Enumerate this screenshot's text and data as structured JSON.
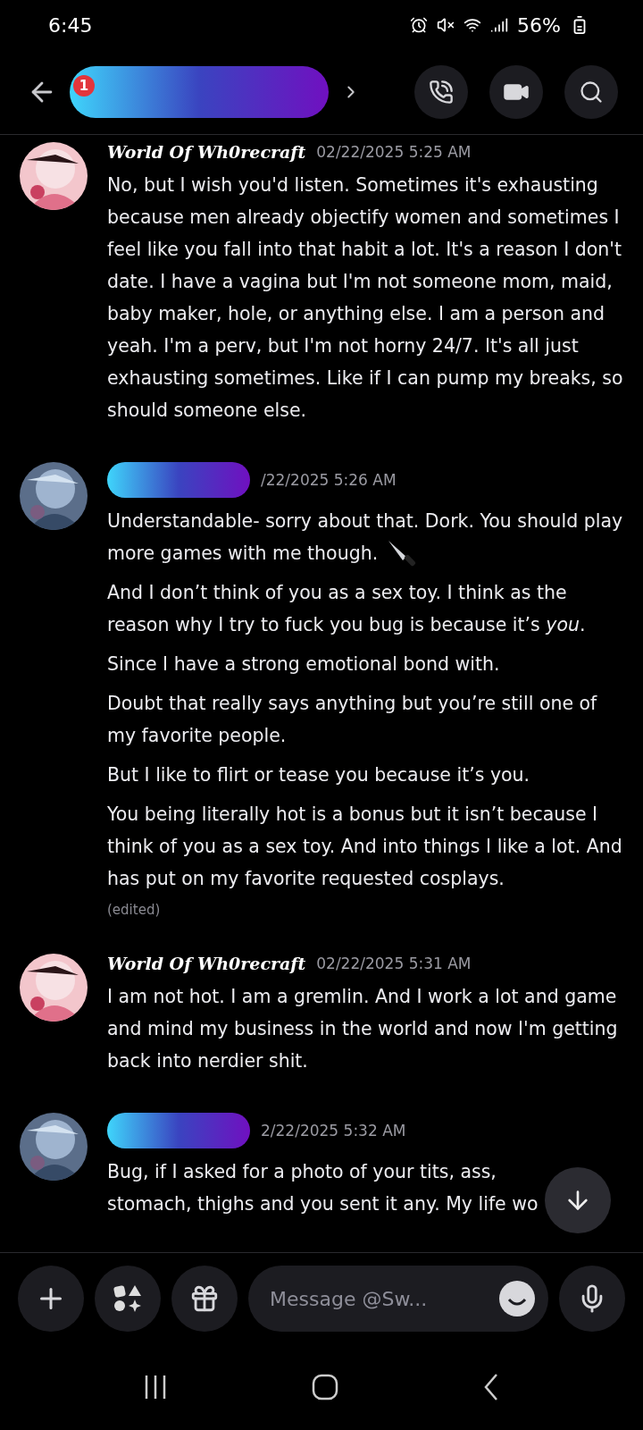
{
  "status_bar": {
    "time": "6:45",
    "battery": "56%"
  },
  "header": {
    "unread_badge": "1"
  },
  "messages": [
    {
      "author": "World Of Wh0recraft",
      "author_redacted": false,
      "timestamp": "02/22/2025 5:25 AM",
      "edited": false,
      "paragraphs": [
        {
          "text": "No, but I wish you'd listen. Sometimes it's exhausting because men already objectify women and sometimes I feel like you fall into that habit a lot. It's a reason I don't date. I have a vagina but I'm not someone mom, maid, baby maker, hole, or anything else. I am a person and yeah. I'm a perv, but I'm not horny 24/7. It's all just exhausting sometimes. Like if I can pump my breaks, so should someone else.",
          "has_emoji": false
        }
      ]
    },
    {
      "author_redacted": true,
      "timestamp": "/22/2025 5:26 AM",
      "edited": true,
      "edited_label": "(edited)",
      "paragraphs": [
        {
          "text": "Understandable- sorry about that. Dork. You should play more games with me though.",
          "has_emoji": true
        },
        {
          "text": "And I don’t think of you as a sex toy. I think as the reason why I try to fuck you bug is because it’s *you*.",
          "has_emoji": false
        },
        {
          "text": "Since I have a strong emotional bond with.",
          "has_emoji": false
        },
        {
          "text": "Doubt that really says anything but you’re still one of my favorite people.",
          "has_emoji": false
        },
        {
          "text": "But I like to flirt or tease you because it’s you.",
          "has_emoji": false
        },
        {
          "text": "You being literally hot is a bonus but it isn’t because I think of you as a sex toy. And into things I like a lot. And has put on my favorite requested cosplays.",
          "has_emoji": false
        }
      ]
    },
    {
      "author": "World Of Wh0recraft",
      "author_redacted": false,
      "timestamp": "02/22/2025 5:31 AM",
      "edited": false,
      "paragraphs": [
        {
          "text": "I am not hot. I am a gremlin. And I work a lot and game and mind my business in the world and now I'm getting back into nerdier shit.",
          "has_emoji": false
        }
      ]
    },
    {
      "author_redacted": true,
      "timestamp": "2/22/2025 5:32 AM",
      "edited": false,
      "paragraphs": [
        {
          "text": "Bug, if I asked for a photo of your tits, ass, stomach, thighs and you sent it any. My life wo",
          "has_emoji": false
        }
      ]
    }
  ],
  "composer": {
    "placeholder": "Message @Sw..."
  }
}
